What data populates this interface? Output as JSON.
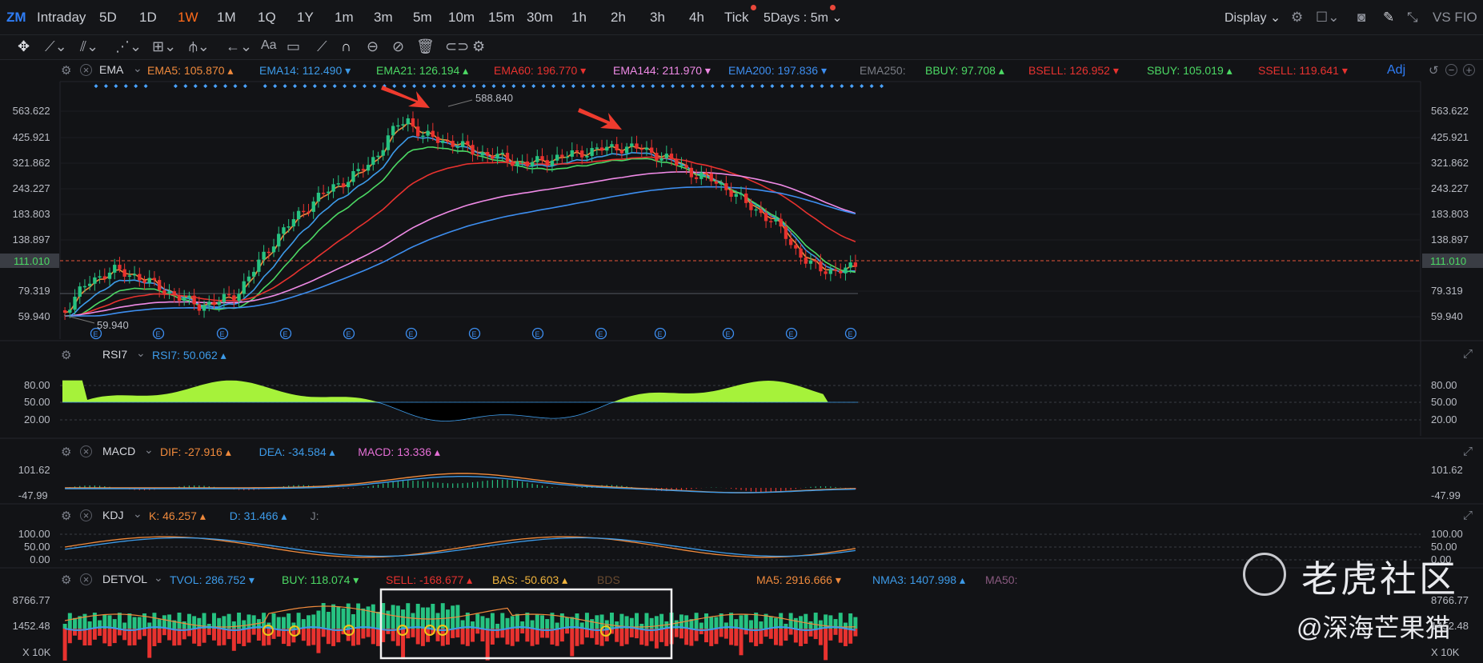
{
  "app": {
    "brand": "ZM"
  },
  "timeframes": [
    "Intraday",
    "5D",
    "1D",
    "1W",
    "1M",
    "1Q",
    "1Y",
    "1m",
    "3m",
    "5m",
    "10m",
    "15m",
    "30m",
    "1h",
    "2h",
    "3h",
    "4h",
    "Tick"
  ],
  "active_timeframe": "1W",
  "multi_period": "5Days : 5m",
  "display_label": "Display",
  "topright_label": "VS FIO",
  "accent_color": "#ff6a1a",
  "main": {
    "indicator": "EMA",
    "legend": [
      {
        "name": "EMA5:",
        "value": "105.870",
        "color": "#f08a3c",
        "dir": "up"
      },
      {
        "name": "EMA14:",
        "value": "112.490",
        "color": "#3d9be9",
        "dir": "down"
      },
      {
        "name": "EMA21:",
        "value": "126.194",
        "color": "#4cd964",
        "dir": "up"
      },
      {
        "name": "EMA60:",
        "value": "196.770",
        "color": "#e8322f",
        "dir": "down"
      },
      {
        "name": "EMA144:",
        "value": "211.970",
        "color": "#ef8ae6",
        "dir": "down"
      },
      {
        "name": "EMA200:",
        "value": "197.836",
        "color": "#3d8ef0",
        "dir": "down"
      },
      {
        "name": "EMA250:",
        "value": "",
        "color": "#7a7d85",
        "dir": ""
      },
      {
        "name": "BBUY:",
        "value": "97.708",
        "color": "#4cd964",
        "dir": "up"
      },
      {
        "name": "BSELL:",
        "value": "126.952",
        "color": "#e8322f",
        "dir": "down"
      },
      {
        "name": "SBUY:",
        "value": "105.019",
        "color": "#4cd964",
        "dir": "up"
      },
      {
        "name": "SSELL:",
        "value": "119.641",
        "color": "#e8322f",
        "dir": "down"
      }
    ],
    "adj_label": "Adj",
    "y_ticks": [
      "563.622",
      "425.921",
      "321.862",
      "243.227",
      "183.803",
      "138.897",
      "79.319",
      "59.940"
    ],
    "current_price": "111.010",
    "high_label": "588.840",
    "low_label": "59.940"
  },
  "rsi": {
    "indicator": "RSI7",
    "legend": [
      {
        "name": "RSI7:",
        "value": "50.062",
        "color": "#3d9be9",
        "dir": "up"
      }
    ],
    "y_ticks": [
      "80.00",
      "50.00",
      "20.00"
    ]
  },
  "macd": {
    "indicator": "MACD",
    "legend": [
      {
        "name": "DIF:",
        "value": "-27.916",
        "color": "#f08a3c",
        "dir": "up"
      },
      {
        "name": "DEA:",
        "value": "-34.584",
        "color": "#3d9be9",
        "dir": "up"
      },
      {
        "name": "MACD:",
        "value": "13.336",
        "color": "#e56fd6",
        "dir": "up"
      }
    ],
    "y_ticks": [
      "101.62",
      "-47.99"
    ]
  },
  "kdj": {
    "indicator": "KDJ",
    "legend": [
      {
        "name": "K:",
        "value": "46.257",
        "color": "#f08a3c",
        "dir": "up"
      },
      {
        "name": "D:",
        "value": "31.466",
        "color": "#3d9be9",
        "dir": "up"
      },
      {
        "name": "J:",
        "value": "",
        "color": "#7a7d85",
        "dir": ""
      }
    ],
    "y_ticks": [
      "100.00",
      "50.00",
      "0.00"
    ]
  },
  "detvol": {
    "indicator": "DETVOL",
    "legend": [
      {
        "name": "TVOL:",
        "value": "286.752",
        "color": "#3d9be9",
        "dir": "down"
      },
      {
        "name": "BUY:",
        "value": "118.074",
        "color": "#4cd964",
        "dir": "down"
      },
      {
        "name": "SELL:",
        "value": "-168.677",
        "color": "#e8322f",
        "dir": "up"
      },
      {
        "name": "BAS:",
        "value": "-50.603",
        "color": "#f0b43c",
        "dir": "up"
      },
      {
        "name": "BDS",
        "value": "",
        "color": "#6a4b30",
        "dir": ""
      },
      {
        "name": "MA5:",
        "value": "2916.666",
        "color": "#f08a3c",
        "dir": "down"
      },
      {
        "name": "NMA3:",
        "value": "1407.998",
        "color": "#3d9be9",
        "dir": "up"
      },
      {
        "name": "MA50:",
        "value": "",
        "color": "#8a5a80",
        "dir": ""
      }
    ],
    "y_ticks": [
      "8766.77",
      "1452.48"
    ],
    "unit_label": "X 10K"
  },
  "watermark": {
    "line1": "老虎社区",
    "line2": "@深海芒果猫"
  }
}
